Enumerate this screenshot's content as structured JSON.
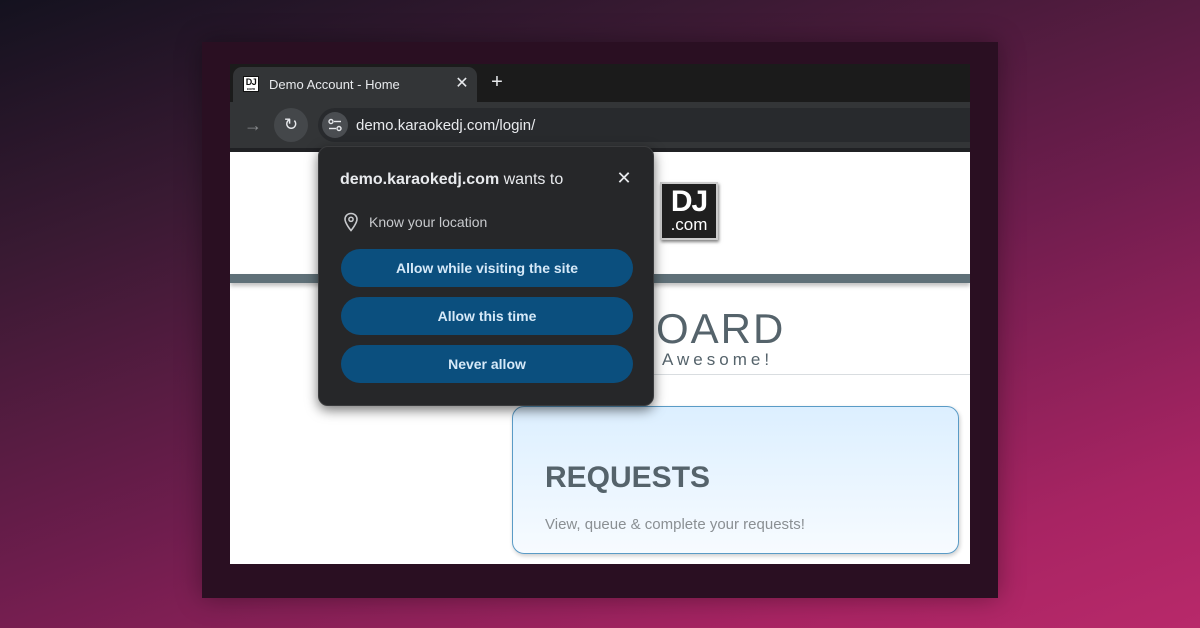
{
  "browser": {
    "tab": {
      "favicon_top": "DJ",
      "favicon_bottom": "com",
      "title": "Demo Account - Home",
      "close": "✕"
    },
    "new_tab": "+",
    "toolbar": {
      "forward": "→",
      "reload": "↻"
    },
    "address_bar": {
      "url": "demo.karaokedj.com/login/"
    }
  },
  "page": {
    "logo": {
      "top": "DJ",
      "bottom": ".com"
    },
    "heading_partial": "OARD",
    "tagline_partial": "Awesome!",
    "requests_card": {
      "title": "REQUESTS",
      "description": "View, queue & complete your requests!"
    }
  },
  "permission_popup": {
    "origin": "demo.karaokedj.com",
    "title_suffix": "wants to",
    "close": "✕",
    "permission_text": "Know your location",
    "buttons": {
      "allow_visit": "Allow while visiting the site",
      "allow_once": "Allow this time",
      "never": "Never allow"
    }
  },
  "colors": {
    "button_bg": "#0b4f7e",
    "popup_bg": "#262729",
    "card_border": "#5a9bc6",
    "header_bar": "#5f7078"
  }
}
